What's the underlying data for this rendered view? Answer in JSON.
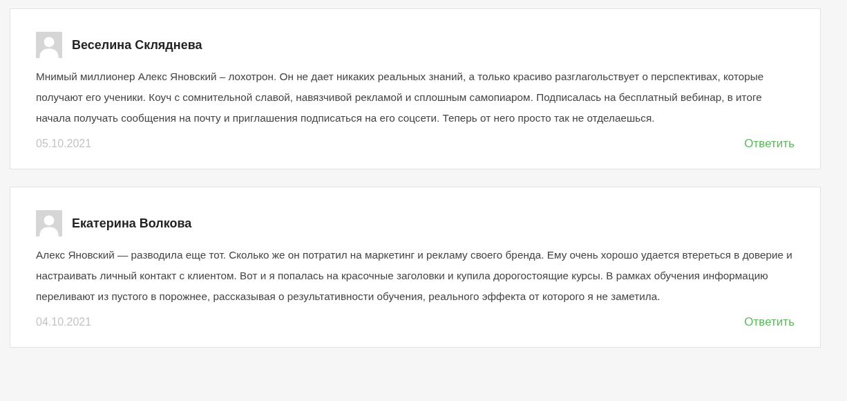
{
  "comments": [
    {
      "author": "Веселина Скляднева",
      "text": "Мнимый миллионер Алекс Яновский – лохотрон. Он не дает никаких реальных знаний, а только красиво разглагольствует о перспективах, которые получают его ученики. Коуч с сомнительной славой, навязчивой рекламой и сплошным самопиаром. Подписалась на бесплатный вебинар, в итоге начала получать сообщения на почту и приглашения подписаться на его соцсети. Теперь от него просто так не отделаешься.",
      "date": "05.10.2021",
      "reply": "Ответить"
    },
    {
      "author": "Екатерина Волкова",
      "text": "Алекс Яновский — разводила еще тот. Сколько же он потратил на маркетинг и рекламу своего бренда. Ему очень хорошо удается втереться в доверие и настраивать личный контакт с клиентом. Вот и я попалась на красочные заголовки и купила дорогостоящие курсы. В рамках обучения информацию переливают из пустого в порожнее, рассказывая о результативности обучения, реального эффекта от которого я не заметила.",
      "date": "04.10.2021",
      "reply": "Ответить"
    }
  ]
}
